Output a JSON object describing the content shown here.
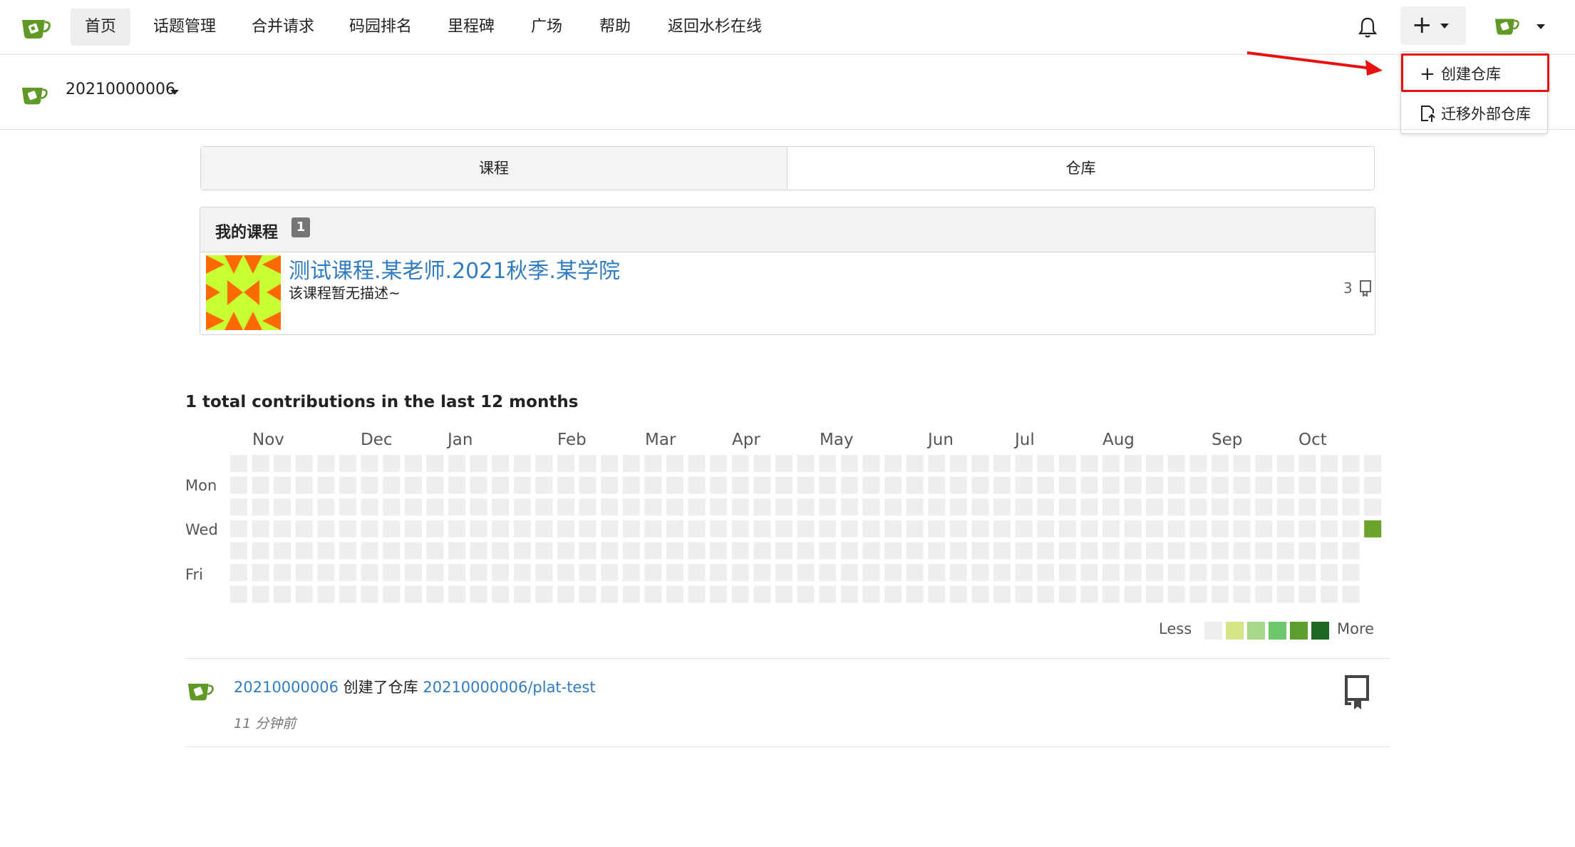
{
  "nav": {
    "items": [
      {
        "label": "首页",
        "active": true
      },
      {
        "label": "话题管理"
      },
      {
        "label": "合并请求"
      },
      {
        "label": "码园排名"
      },
      {
        "label": "里程碑"
      },
      {
        "label": "广场"
      },
      {
        "label": "帮助"
      },
      {
        "label": "返回水杉在线"
      }
    ],
    "plus_glyph": "+",
    "icons": [
      "gitea-logo-icon",
      "bell-icon",
      "plus-icon",
      "avatar-icon"
    ]
  },
  "dropdown": {
    "create_repo": "创建仓库",
    "migrate_repo": "迁移外部仓库",
    "create_glyph": "+"
  },
  "header": {
    "username": "20210000006"
  },
  "tabs": {
    "course": "课程",
    "repo": "仓库"
  },
  "courses": {
    "title": "我的课程",
    "count": "1",
    "item": {
      "name": "测试课程.某老师.2021秋季.某学院",
      "description": "该课程暂无描述~",
      "repo_count": "3"
    }
  },
  "contrib": {
    "title": "1 total contributions in the last 12 months",
    "months": [
      "Nov",
      "Dec",
      "Jan",
      "Feb",
      "Mar",
      "Apr",
      "May",
      "Jun",
      "Jul",
      "Aug",
      "Sep",
      "Oct"
    ],
    "days": [
      "Mon",
      "Wed",
      "Fri"
    ],
    "less": "Less",
    "more": "More",
    "empty_color": "#eeeeee",
    "active_color": "#6aa22c",
    "scale_colors": [
      "#eeeeee",
      "#d6e685",
      "#a6d98c",
      "#6cc86a",
      "#5b9e2d",
      "#1e6823"
    ],
    "active_cell": {
      "column": 52,
      "row": 3
    }
  },
  "feed": {
    "user": "20210000006",
    "action": "创建了仓库",
    "repo": "20210000006/plat-test",
    "time": "11 分钟前"
  },
  "colors": {
    "link": "#2f7bc4",
    "highlight_box": "#e81010",
    "logo_green": "#609926"
  }
}
